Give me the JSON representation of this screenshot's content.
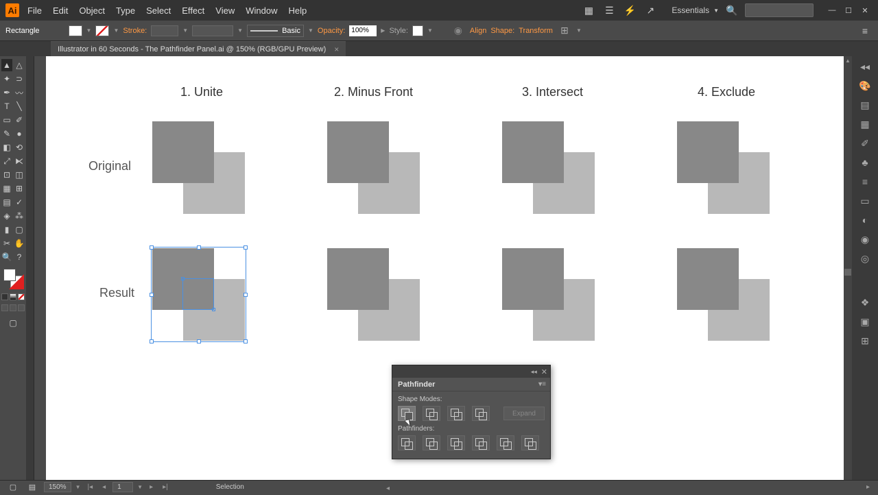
{
  "app": {
    "logo": "Ai"
  },
  "menu": [
    "File",
    "Edit",
    "Object",
    "Type",
    "Select",
    "Effect",
    "View",
    "Window",
    "Help"
  ],
  "workspace": "Essentials",
  "window_buttons": [
    "minimize",
    "maximize",
    "close"
  ],
  "control_bar": {
    "shape": "Rectangle",
    "stroke_label": "Stroke:",
    "basic": "Basic",
    "opacity_label": "Opacity:",
    "opacity_value": "100%",
    "style_label": "Style:",
    "align": "Align",
    "shape_link": "Shape:",
    "transform": "Transform"
  },
  "doc_tab": {
    "title": "Illustrator in 60 Seconds - The Pathfinder Panel.ai @ 150% (RGB/GPU Preview)",
    "close": "×"
  },
  "canvas": {
    "columns": [
      "1. Unite",
      "2. Minus Front",
      "3. Intersect",
      "4. Exclude"
    ],
    "rows": [
      "Original",
      "Result"
    ]
  },
  "pathfinder": {
    "title": "Pathfinder",
    "shape_modes_label": "Shape Modes:",
    "pathfinders_label": "Pathfinders:",
    "shape_modes": [
      "unite",
      "minus-front",
      "intersect",
      "exclude"
    ],
    "pathfinders": [
      "divide",
      "trim",
      "merge",
      "crop",
      "outline",
      "minus-back"
    ],
    "expand": "Expand"
  },
  "status": {
    "zoom": "150%",
    "page": "1",
    "tool": "Selection"
  }
}
